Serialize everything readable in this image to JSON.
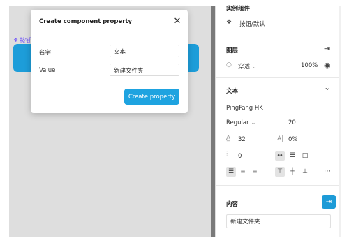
{
  "canvas": {
    "frame_label": "按钮",
    "frame_icon": "component-diamond-icon"
  },
  "dialog": {
    "title": "Create component property",
    "close_icon": "close-icon",
    "fields": [
      {
        "label": "名字",
        "value": "文本"
      },
      {
        "label": "Value",
        "value": "新建文件夹"
      }
    ],
    "primary_button": "Create property"
  },
  "panel": {
    "instance_section_title": "实例组件",
    "instance_name": "按钮/默认",
    "layer": {
      "title": "图层",
      "blend_mode": "穿透",
      "opacity": "100%"
    },
    "text": {
      "title": "文本",
      "font_family": "PingFang HK",
      "font_weight": "Regular",
      "font_size": "20",
      "line_height": "32",
      "letter_spacing": "0%",
      "paragraph_spacing": "0"
    },
    "content": {
      "title": "内容",
      "value": "新建文件夹"
    }
  },
  "colors": {
    "accent": "#1ea3e0",
    "component": "#7b61ff"
  }
}
